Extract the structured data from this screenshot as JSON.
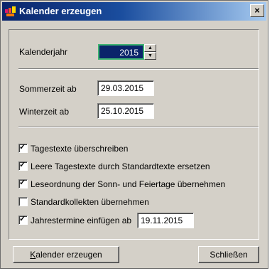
{
  "window": {
    "title": "Kalender erzeugen",
    "close_glyph": "×"
  },
  "calendar_year": {
    "label": "Kalenderjahr",
    "value": "2015",
    "spin_up": "▲",
    "spin_down": "▼"
  },
  "summer_time": {
    "label": "Sommerzeit ab",
    "value": "29.03.2015"
  },
  "winter_time": {
    "label": "Winterzeit ab",
    "value": "25.10.2015"
  },
  "options": [
    {
      "label": "Tagestexte überschreiben",
      "checked": true
    },
    {
      "label": "Leere Tagestexte durch Standardtexte ersetzen",
      "checked": true
    },
    {
      "label": "Leseordnung der Sonn- und Feiertage übernehmen",
      "checked": true
    },
    {
      "label": "Standardkollekten übernehmen",
      "checked": false
    },
    {
      "label": "Jahrestermine einfügen ab",
      "checked": true
    }
  ],
  "annual_dates": {
    "value": "19.11.2015"
  },
  "buttons": {
    "create_mnemonic": "K",
    "create_rest": "alender erzeugen",
    "close": "Schließen"
  },
  "check_glyph": "✓"
}
